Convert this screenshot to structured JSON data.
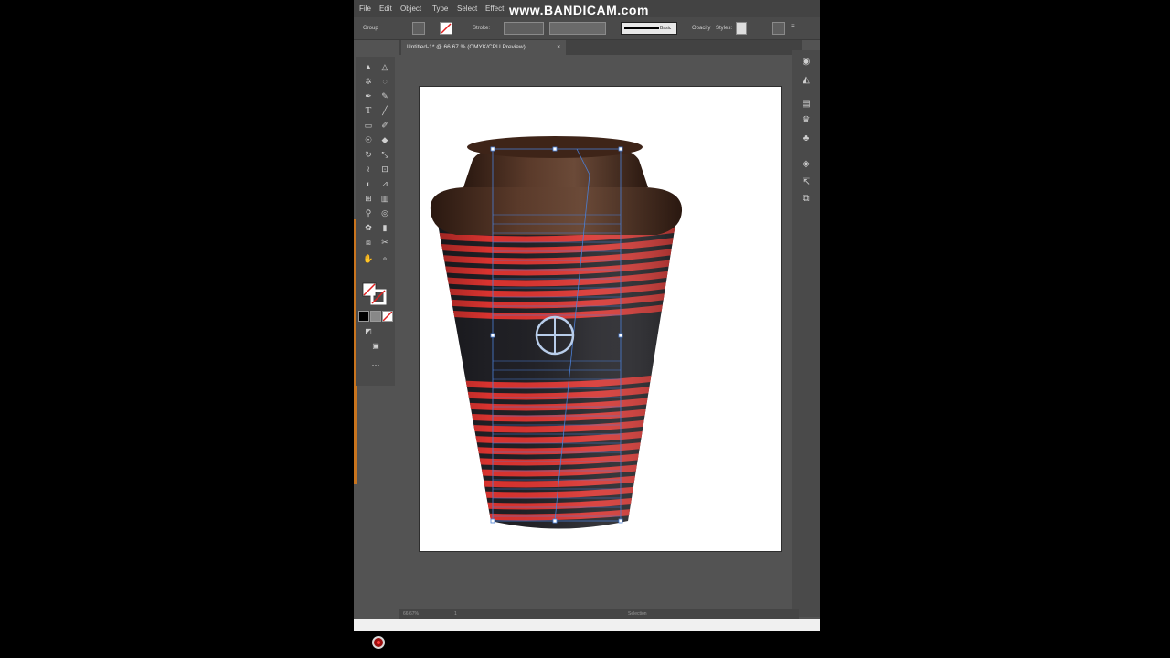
{
  "menubar": {
    "items": [
      "File",
      "Edit",
      "Object",
      "Type",
      "Select",
      "Effect"
    ],
    "watermark": "www.BANDICAM.com"
  },
  "controlbar": {
    "selection_label": "Group",
    "stroke_label": "Stroke:",
    "brush_label": "Basic",
    "opacity_label": "Opacity",
    "styles_label": "Styles:"
  },
  "document": {
    "tab_title": "Untitled-1* @ 66.67 % (CMYK/CPU Preview)",
    "close_glyph": "×"
  },
  "statusbar": {
    "zoom": "66.67%",
    "page": "1",
    "tool": "Selection"
  },
  "toolbox": {
    "tools": [
      "selection",
      "direct-selection",
      "magic-wand",
      "lasso",
      "pen",
      "curvature",
      "type",
      "line",
      "rectangle",
      "paintbrush",
      "shaper",
      "eraser",
      "rotate",
      "scale",
      "warp",
      "free-transform",
      "shape-builder",
      "perspective",
      "mesh",
      "gradient",
      "eyedropper",
      "blend",
      "symbol-sprayer",
      "column-graph",
      "artboard",
      "slice",
      "hand",
      "zoom"
    ]
  },
  "colors": {
    "cup_red": "#d8332f",
    "cup_dark": "#1f1f24",
    "lid_brown": "#4a2c20",
    "selection_blue": "#4a7fd6",
    "ui_dark": "#535353",
    "artboard": "#ffffff",
    "record": "#b01212"
  }
}
